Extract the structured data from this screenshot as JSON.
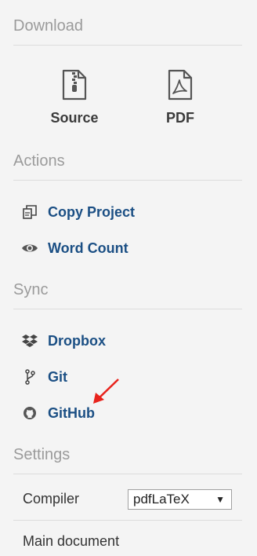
{
  "download": {
    "heading": "Download",
    "items": [
      {
        "label": "Source",
        "icon": "zip-file-icon"
      },
      {
        "label": "PDF",
        "icon": "pdf-file-icon"
      }
    ]
  },
  "actions": {
    "heading": "Actions",
    "items": [
      {
        "label": "Copy Project",
        "icon": "copy-icon"
      },
      {
        "label": "Word Count",
        "icon": "eye-icon"
      }
    ]
  },
  "sync": {
    "heading": "Sync",
    "items": [
      {
        "label": "Dropbox",
        "icon": "dropbox-icon"
      },
      {
        "label": "Git",
        "icon": "git-branch-icon"
      },
      {
        "label": "GitHub",
        "icon": "github-icon"
      }
    ]
  },
  "settings": {
    "heading": "Settings",
    "compiler_label": "Compiler",
    "compiler_value": "pdfLaTeX",
    "main_document_label": "Main document"
  },
  "colors": {
    "heading": "#9b9b9b",
    "link": "#1b4f84",
    "annotation_arrow": "#e8231c"
  }
}
